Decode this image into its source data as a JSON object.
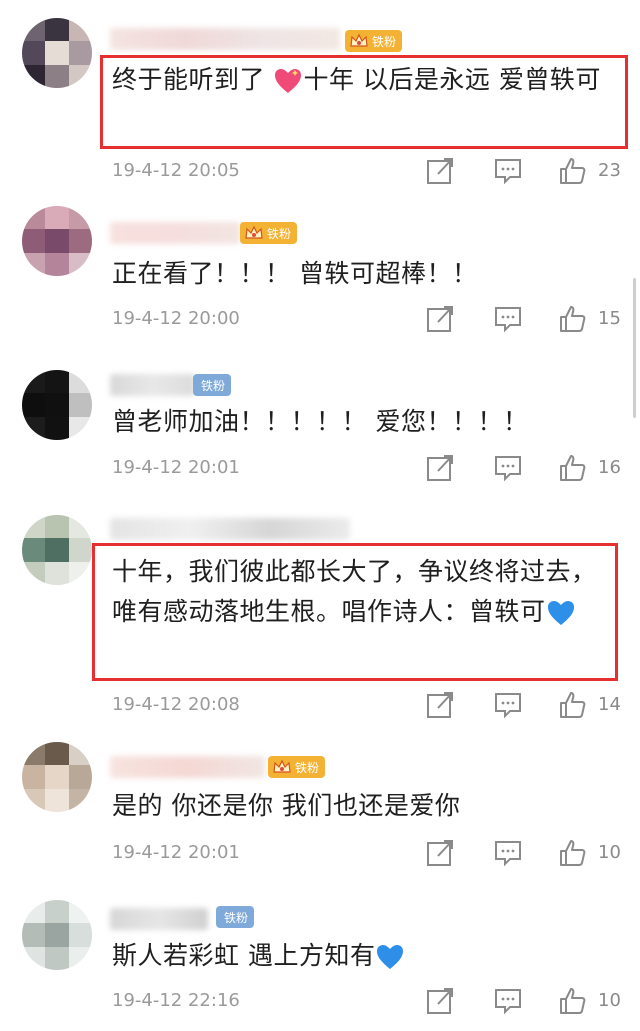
{
  "comments": [
    {
      "text": "终于能听到了     十年 以后是永远 爱曾轶可",
      "text_before_emoji": "终于能听到了 ",
      "emoji": "heart-sparkle",
      "text_after_emoji": "十年  以后是永远  爱曾轶可",
      "badge": "铁粉",
      "badge_style": "gold",
      "time": "19-4-12 20:05",
      "likes": "23",
      "highlighted": true
    },
    {
      "text": "正在看了！！！ 曾轶可超棒！！",
      "badge": "铁粉",
      "badge_style": "gold",
      "time": "19-4-12 20:00",
      "likes": "15",
      "highlighted": false
    },
    {
      "text": "曾老师加油！！！！！ 爱您！！！！",
      "badge": "铁粉",
      "badge_style": "blue",
      "time": "19-4-12 20:01",
      "likes": "16",
      "highlighted": false
    },
    {
      "text": "十年，我们彼此都长大了，争议终将过去，唯有感动落地生根。唱作诗人：曾轶可",
      "emoji": "blue-heart",
      "time": "19-4-12 20:08",
      "likes": "14",
      "highlighted": true
    },
    {
      "text": "是的 你还是你 我们也还是爱你",
      "badge": "铁粉",
      "badge_style": "gold",
      "time": "19-4-12 20:01",
      "likes": "10",
      "highlighted": false
    },
    {
      "text": "斯人若彩虹 遇上方知有",
      "emoji": "blue-heart",
      "badge": "铁粉",
      "badge_style": "blue",
      "time": "19-4-12 22:16",
      "likes": "10",
      "highlighted": false
    }
  ],
  "icons": {
    "share": "share-icon",
    "reply": "comment-icon",
    "like": "thumbs-up-icon"
  },
  "colors": {
    "highlight_border": "#e6302f",
    "badge_gold": "#f3b234",
    "badge_blue": "#7fa9d9",
    "meta_text": "#9a9a9a"
  }
}
